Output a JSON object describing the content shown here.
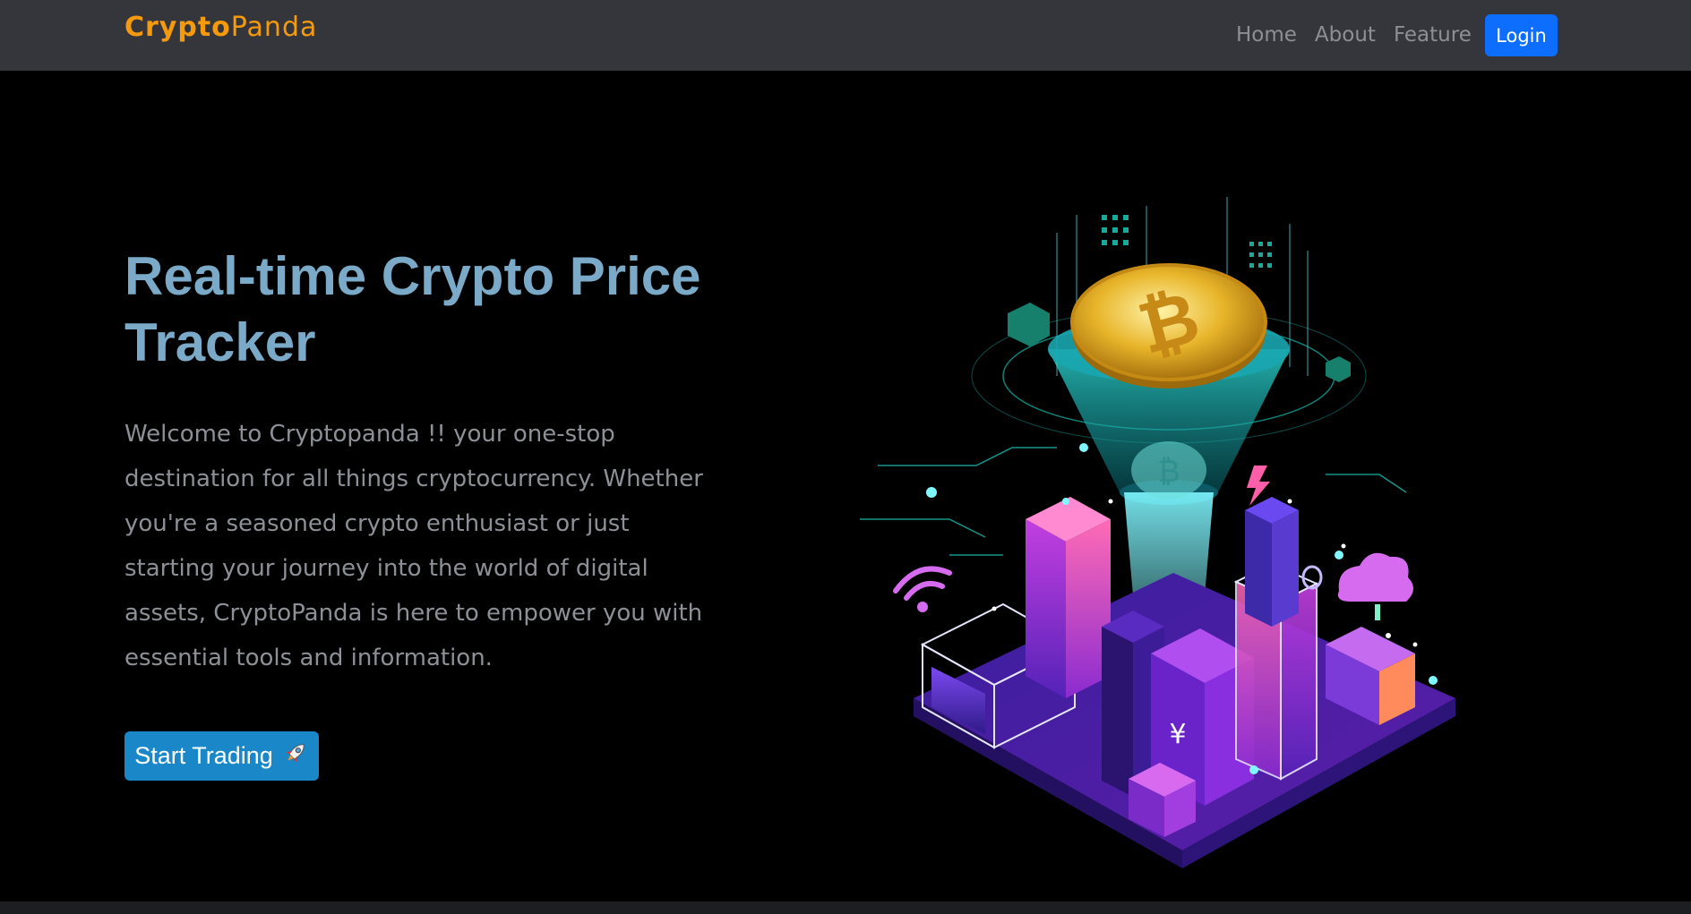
{
  "brand": {
    "part1": "Crypto",
    "part2": "Panda",
    "color": "#f59a0c"
  },
  "nav": {
    "links": [
      "Home",
      "About",
      "Feature"
    ],
    "login_label": "Login",
    "bg_color": "#35363b",
    "login_color": "#0d6efd"
  },
  "hero": {
    "title": "Real-time Crypto Price Tracker",
    "description": "Welcome to Cryptopanda !! your one-stop destination for all things cryptocurrency. Whether you're a seasoned crypto enthusiast or just starting your journey into the world of digital assets, CryptoPanda is here to empower you with essential tools and information.",
    "cta_label": "Start Trading",
    "cta_icon": "rocket-icon",
    "title_color": "#7aaac7",
    "cta_color": "#1a88c8"
  },
  "illustration": {
    "icon": "crypto-city-illustration-icon",
    "coin_icon": "bitcoin-coin-icon"
  }
}
